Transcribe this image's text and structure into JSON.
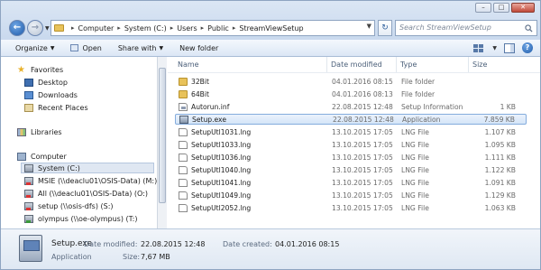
{
  "titlebar": {
    "buttons": [
      "–",
      "□",
      "✕"
    ]
  },
  "address": {
    "crumbs": [
      "Computer",
      "System (C:)",
      "Users",
      "Public",
      "StreamViewSetup"
    ],
    "refresh_icon": "refresh-icon",
    "search_placeholder": "Search StreamViewSetup"
  },
  "toolbar": {
    "organize": "Organize",
    "open": "Open",
    "share": "Share with",
    "new_folder": "New folder"
  },
  "nav": {
    "favorites": "Favorites",
    "desktop": "Desktop",
    "downloads": "Downloads",
    "recent": "Recent Places",
    "libraries": "Libraries",
    "computer": "Computer",
    "drives": [
      "System (C:)",
      "MSIE (\\\\deaclu01\\OSIS-Data) (M:)",
      "All (\\\\deaclu01\\OSIS-Data) (O:)",
      "setup (\\\\osis-dfs) (S:)",
      "olympus (\\\\oe-olympus) (T:)"
    ]
  },
  "columns": {
    "name": "Name",
    "date": "Date modified",
    "type": "Type",
    "size": "Size"
  },
  "files": [
    {
      "name": "32Bit",
      "date": "04.01.2016 08:15",
      "type": "File folder",
      "size": "",
      "icon": "folder-icon"
    },
    {
      "name": "64Bit",
      "date": "04.01.2016 08:13",
      "type": "File folder",
      "size": "",
      "icon": "folder-icon"
    },
    {
      "name": "Autorun.inf",
      "date": "22.08.2015 12:48",
      "type": "Setup Information",
      "size": "1 KB",
      "icon": "inf-file-icon"
    },
    {
      "name": "Setup.exe",
      "date": "22.08.2015 12:48",
      "type": "Application",
      "size": "7.859 KB",
      "icon": "exe-file-icon"
    },
    {
      "name": "SetupUtl1031.lng",
      "date": "13.10.2015 17:05",
      "type": "LNG File",
      "size": "1.107 KB",
      "icon": "lng-file-icon"
    },
    {
      "name": "SetupUtl1033.lng",
      "date": "13.10.2015 17:05",
      "type": "LNG File",
      "size": "1.095 KB",
      "icon": "lng-file-icon"
    },
    {
      "name": "SetupUtl1036.lng",
      "date": "13.10.2015 17:05",
      "type": "LNG File",
      "size": "1.111 KB",
      "icon": "lng-file-icon"
    },
    {
      "name": "SetupUtl1040.lng",
      "date": "13.10.2015 17:05",
      "type": "LNG File",
      "size": "1.122 KB",
      "icon": "lng-file-icon"
    },
    {
      "name": "SetupUtl1041.lng",
      "date": "13.10.2015 17:05",
      "type": "LNG File",
      "size": "1.091 KB",
      "icon": "lng-file-icon"
    },
    {
      "name": "SetupUtl1049.lng",
      "date": "13.10.2015 17:05",
      "type": "LNG File",
      "size": "1.129 KB",
      "icon": "lng-file-icon"
    },
    {
      "name": "SetupUtl2052.lng",
      "date": "13.10.2015 17:05",
      "type": "LNG File",
      "size": "1.063 KB",
      "icon": "lng-file-icon"
    }
  ],
  "details": {
    "name": "Setup.exe",
    "type": "Application",
    "modified_label": "Date modified:",
    "modified_value": "22.08.2015 12:48",
    "created_label": "Date created:",
    "created_value": "04.01.2016 08:15",
    "size_label": "Size:",
    "size_value": "7,67 MB"
  }
}
